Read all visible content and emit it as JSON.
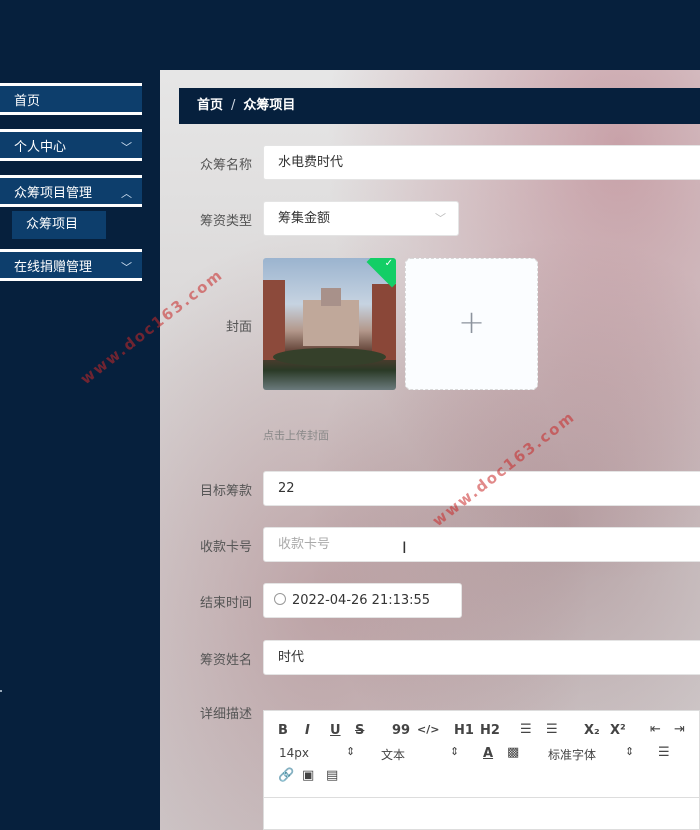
{
  "sidebar": {
    "items": [
      {
        "label": "首页"
      },
      {
        "label": "个人中心",
        "chevron": "chevron-down-icon"
      },
      {
        "label": "众筹项目管理",
        "chevron": "chevron-up-icon"
      },
      {
        "label": "在线捐赠管理",
        "chevron": "chevron-down-icon"
      }
    ],
    "submenu": {
      "label": "众筹项目"
    }
  },
  "breadcrumb": {
    "home": "首页",
    "separator": "/",
    "current": "众筹项目"
  },
  "form": {
    "name": {
      "label": "众筹名称",
      "value": "水电费时代"
    },
    "type": {
      "label": "筹资类型",
      "value": "筹集金额"
    },
    "cover": {
      "label": "封面",
      "hint": "点击上传封面",
      "add_symbol": "+",
      "check": "✓"
    },
    "target": {
      "label": "目标筹款",
      "value": "22"
    },
    "card": {
      "label": "收款卡号",
      "placeholder": "收款卡号"
    },
    "end_time": {
      "label": "结束时间",
      "value": "2022-04-26 21:13:55"
    },
    "person": {
      "label": "筹资姓名",
      "value": "时代"
    },
    "detail": {
      "label": "详细描述"
    }
  },
  "editor": {
    "toolbar": {
      "bold": "B",
      "italic": "I",
      "underline": "U",
      "strike": "S",
      "quote": "99",
      "code": "</>",
      "h1": "H1",
      "h2": "H2",
      "sub": "X₂",
      "sup": "X²",
      "size": "14px",
      "header": "文本",
      "font": "标准字体"
    }
  },
  "watermark": "www.doc163.com",
  "colors": {
    "sidebar_bg": "#06203d",
    "menu_bg": "#0d3e6c",
    "success": "#13ce66"
  }
}
